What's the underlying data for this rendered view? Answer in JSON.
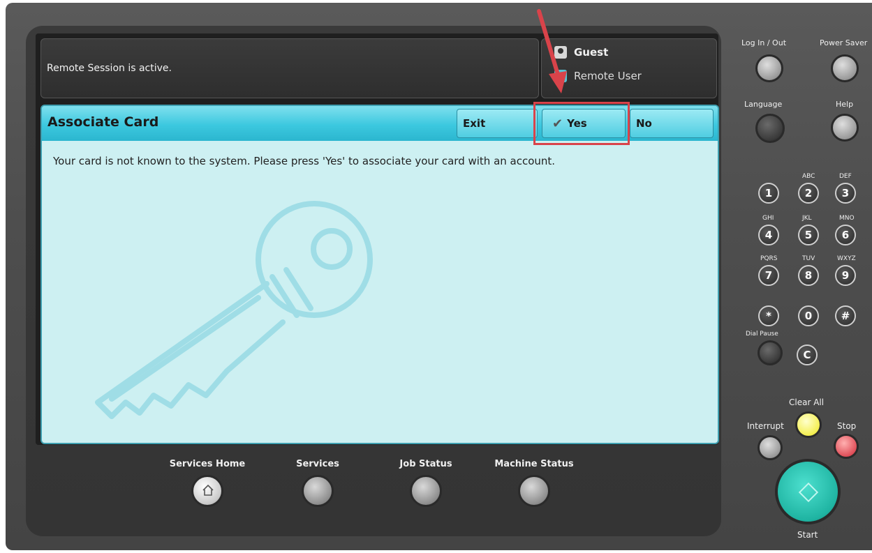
{
  "status": {
    "message": "Remote Session is active.",
    "user_primary": "Guest",
    "user_secondary": "Remote User"
  },
  "dialog": {
    "title": "Associate Card",
    "buttons": {
      "exit": "Exit",
      "yes": "Yes",
      "no": "No"
    },
    "message": "Your card is not known to the system. Please press 'Yes' to associate your card with an account."
  },
  "bottom_nav": {
    "services_home": "Services Home",
    "services": "Services",
    "job_status": "Job Status",
    "machine_status": "Machine Status"
  },
  "side_panel": {
    "log_in_out": "Log In / Out",
    "power_saver": "Power Saver",
    "language": "Language",
    "help": "Help",
    "keys": [
      {
        "digit": "1",
        "letters": ""
      },
      {
        "digit": "2",
        "letters": "ABC"
      },
      {
        "digit": "3",
        "letters": "DEF"
      },
      {
        "digit": "4",
        "letters": "GHI"
      },
      {
        "digit": "5",
        "letters": "JKL"
      },
      {
        "digit": "6",
        "letters": "MNO"
      },
      {
        "digit": "7",
        "letters": "PQRS"
      },
      {
        "digit": "8",
        "letters": "TUV"
      },
      {
        "digit": "9",
        "letters": "WXYZ"
      },
      {
        "digit": "*",
        "letters": ""
      },
      {
        "digit": "0",
        "letters": ""
      },
      {
        "digit": "#",
        "letters": ""
      }
    ],
    "dial_pause": "Dial Pause",
    "c_key": "C",
    "clear_all": "Clear All",
    "interrupt": "Interrupt",
    "stop": "Stop",
    "start": "Start"
  },
  "colors": {
    "dialog_bg": "#cdf0f2",
    "header_accent": "#3cc8df",
    "highlight": "#d9434a",
    "start_button": "#1fb4a2",
    "clear_all_button": "#f4ef52",
    "stop_button": "#e0505a"
  }
}
